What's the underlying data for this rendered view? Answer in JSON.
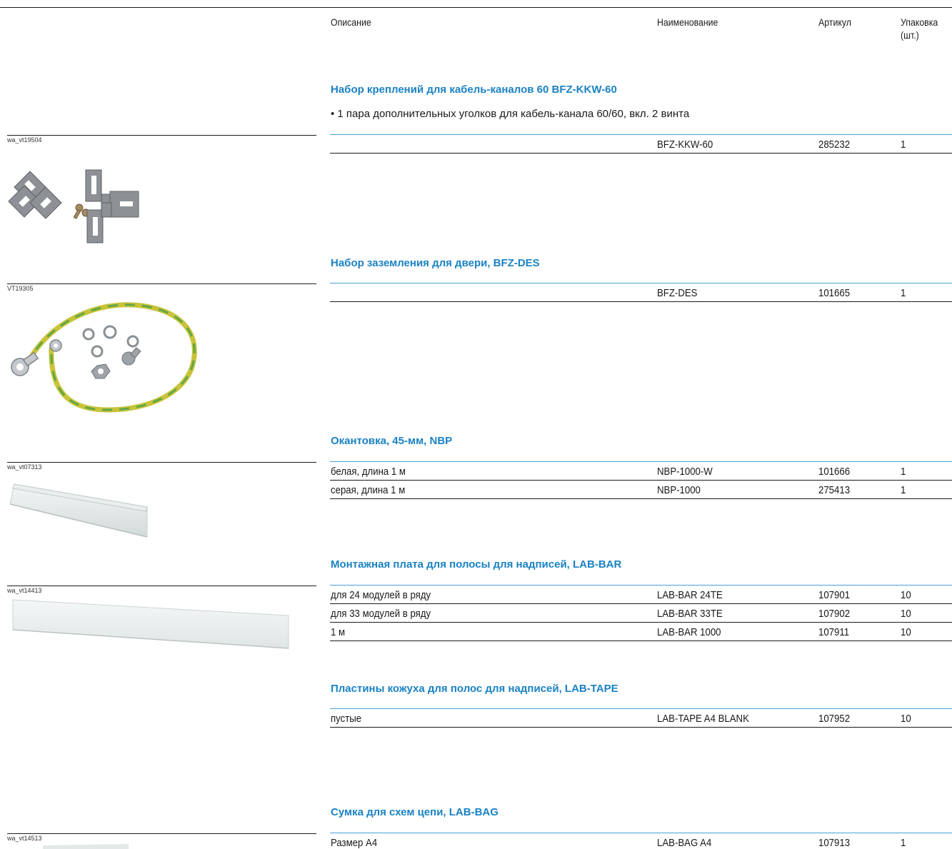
{
  "headers": {
    "description": "Описание",
    "name": "Наименование",
    "article": "Артикул",
    "pack_line1": "Упаковка",
    "pack_line2": "(шт.)"
  },
  "sections": [
    {
      "title": "Набор креплений для кабель-каналов 60 BFZ-KKW-60",
      "bullet": "• 1 пара дополнительных уголков для кабель-канала 60/60, вкл. 2 винта",
      "image_code": "wa_vt19504",
      "image_icon": "bracket-set-icon",
      "rows": [
        {
          "desc": "",
          "name": "BFZ-KKW-60",
          "article": "285232",
          "pack": "1"
        }
      ]
    },
    {
      "title": "Набор заземления для двери, BFZ-DES",
      "image_code": "VT19305",
      "image_icon": "grounding-cable-icon",
      "rows": [
        {
          "desc": "",
          "name": "BFZ-DES",
          "article": "101665",
          "pack": "1"
        }
      ]
    },
    {
      "title": "Окантовка, 45-мм, NBP",
      "image_code": "wa_vt07313",
      "image_icon": "edge-profile-icon",
      "rows": [
        {
          "desc": "белая, длина 1 м",
          "name": "NBP-1000-W",
          "article": "101666",
          "pack": "1"
        },
        {
          "desc": "серая, длина 1 м",
          "name": "NBP-1000",
          "article": "275413",
          "pack": "1"
        }
      ]
    },
    {
      "title": "Монтажная плата для полосы для надписей, LAB-BAR",
      "image_code": "wa_vt14413",
      "image_icon": "label-bar-icon",
      "rows": [
        {
          "desc": "для 24 модулей в ряду",
          "name": "LAB-BAR 24TE",
          "article": "107901",
          "pack": "10"
        },
        {
          "desc": "для 33 модулей в ряду",
          "name": "LAB-BAR 33TE",
          "article": "107902",
          "pack": "10"
        },
        {
          "desc": "1 м",
          "name": "LAB-BAR 1000",
          "article": "107911",
          "pack": "10"
        }
      ]
    },
    {
      "title": "Пластины кожуха для полос для надписей, LAB-TAPE",
      "rows": [
        {
          "desc": "пустые",
          "name": "LAB-TAPE A4 BLANK",
          "article": "107952",
          "pack": "10"
        }
      ]
    },
    {
      "title": "Сумка для схем цепи, LAB-BAG",
      "image_code": "wa_vt14513",
      "image_icon": "circuit-bag-icon",
      "rows": [
        {
          "desc": "Размер A4",
          "name": "LAB-BAG A4",
          "article": "107913",
          "pack": "1"
        }
      ]
    }
  ]
}
